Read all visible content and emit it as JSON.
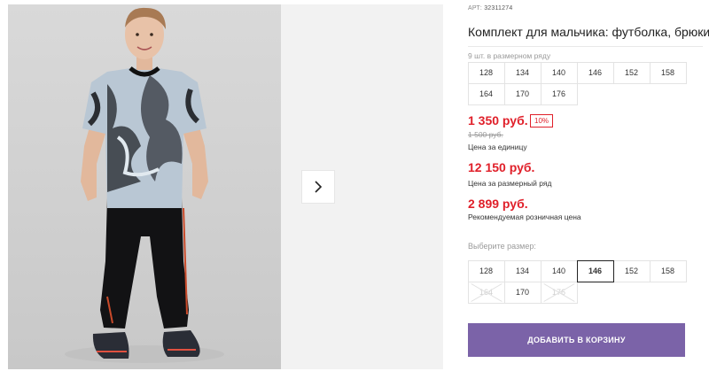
{
  "product": {
    "sku_label": "АРТ:",
    "sku_value": "32311274",
    "title": "Комплект для мальчика: футболка, брюки",
    "row_note": "9 шт. в размерном ряду",
    "size_row": [
      "128",
      "134",
      "140",
      "146",
      "152",
      "158",
      "164",
      "170",
      "176"
    ]
  },
  "pricing": {
    "unit_price": "1 350 руб.",
    "discount": "10%",
    "old_price": "1 500 руб.",
    "unit_caption": "Цена за единицу",
    "row_price": "12 150 руб.",
    "row_caption": "Цена за размерный ряд",
    "retail_price": "2 899 руб.",
    "retail_caption": "Рекомендуемая розничная цена"
  },
  "size_picker": {
    "label": "Выберите размер:",
    "options": [
      {
        "size": "128",
        "state": "available"
      },
      {
        "size": "134",
        "state": "available"
      },
      {
        "size": "140",
        "state": "available"
      },
      {
        "size": "146",
        "state": "selected"
      },
      {
        "size": "152",
        "state": "available"
      },
      {
        "size": "158",
        "state": "available"
      },
      {
        "size": "164",
        "state": "disabled"
      },
      {
        "size": "170",
        "state": "available"
      },
      {
        "size": "176",
        "state": "disabled"
      }
    ]
  },
  "cart_button": {
    "label": "ДОБАВИТЬ В КОРЗИНУ"
  },
  "gallery": {
    "next_icon": "chevron-right-icon"
  },
  "colors": {
    "accent": "#7b63a8",
    "price": "#e0202a"
  }
}
